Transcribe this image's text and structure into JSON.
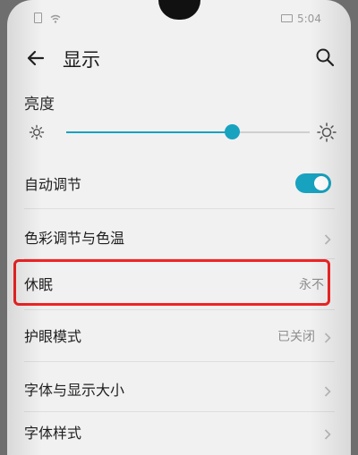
{
  "status_bar": {
    "time": "5:04"
  },
  "header": {
    "title": "显示",
    "back_icon": "arrow-left-icon",
    "search_icon": "search-icon"
  },
  "brightness": {
    "label": "亮度",
    "level": 0.68,
    "min_icon": "sun-small-icon",
    "max_icon": "sun-large-icon"
  },
  "settings": {
    "auto_adjust": {
      "label": "自动调节",
      "enabled": true
    },
    "color": {
      "label": "色彩调节与色温"
    },
    "sleep": {
      "label": "休眠",
      "value": "永不"
    },
    "eye_comfort": {
      "label": "护眼模式",
      "value": "已关闭"
    },
    "font_display_size": {
      "label": "字体与显示大小"
    },
    "font_style": {
      "label": "字体样式"
    }
  },
  "colors": {
    "accent": "#17a2c0",
    "highlight": "#f02424"
  }
}
